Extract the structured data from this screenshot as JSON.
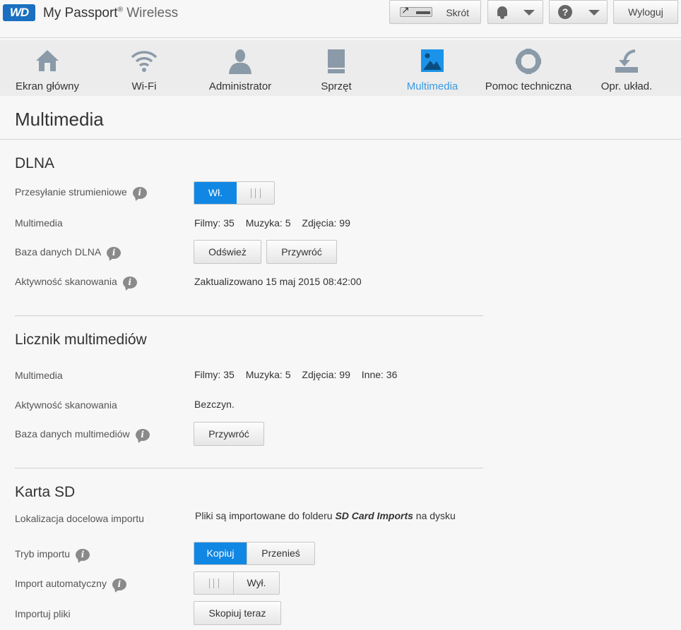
{
  "header": {
    "logo": "WD",
    "brand_main": "My Passport",
    "brand_reg": "®",
    "brand_sub": "Wireless",
    "shortcut_label": "Skrót",
    "logout_label": "Wyloguj",
    "help_glyph": "?"
  },
  "nav": {
    "items": [
      {
        "label": "Ekran główny",
        "icon": "home-icon"
      },
      {
        "label": "Wi-Fi",
        "icon": "wifi-icon"
      },
      {
        "label": "Administrator",
        "icon": "user-icon"
      },
      {
        "label": "Sprzęt",
        "icon": "hardware-icon"
      },
      {
        "label": "Multimedia",
        "icon": "multimedia-icon",
        "active": true
      },
      {
        "label": "Pomoc techniczna",
        "icon": "lifebuoy-icon"
      },
      {
        "label": "Opr. układ.",
        "icon": "firmware-icon"
      }
    ],
    "active_color": "#3a9ae0"
  },
  "page": {
    "title": "Multimedia"
  },
  "dlna": {
    "title": "DLNA",
    "streaming": {
      "label": "Przesyłanie strumieniowe",
      "on": "Wł."
    },
    "media": {
      "label": "Multimedia",
      "films": "Filmy: 35",
      "music": "Muzyka: 5",
      "photos": "Zdjęcia: 99"
    },
    "db": {
      "label": "Baza danych DLNA",
      "refresh": "Odśwież",
      "restore": "Przywróć"
    },
    "scan": {
      "label": "Aktywność skanowania",
      "value": "Zaktualizowano 15 maj 2015 08:42:00"
    }
  },
  "counter": {
    "title": "Licznik multimediów",
    "media": {
      "label": "Multimedia",
      "films": "Filmy: 35",
      "music": "Muzyka: 5",
      "photos": "Zdjęcia: 99",
      "other": "Inne: 36"
    },
    "scan": {
      "label": "Aktywność skanowania",
      "value": "Bezczyn."
    },
    "db": {
      "label": "Baza danych multimediów",
      "restore": "Przywróć"
    }
  },
  "sd": {
    "title": "Karta SD",
    "location": {
      "label": "Lokalizacja docelowa importu",
      "prefix": "Pliki są importowane do folderu ",
      "folder": "SD Card Imports",
      "suffix": " na dysku"
    },
    "mode": {
      "label": "Tryb importu",
      "copy": "Kopiuj",
      "move": "Przenieś"
    },
    "auto": {
      "label": "Import automatyczny",
      "off": "Wył."
    },
    "files": {
      "label": "Importuj pliki",
      "button": "Skopiuj teraz"
    }
  },
  "colors": {
    "accent": "#1187e4",
    "logo": "#1a6fc0"
  }
}
